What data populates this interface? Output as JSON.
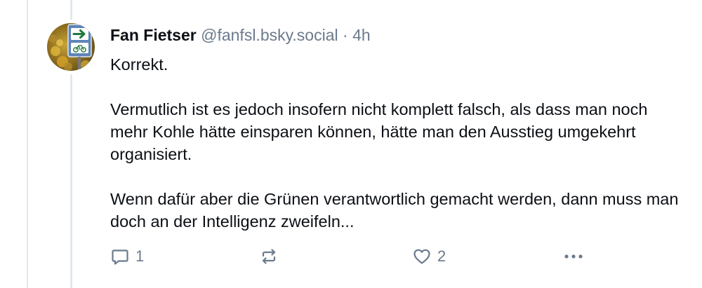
{
  "post": {
    "author_name": "Fan Fietser",
    "handle": "@fanfsl.bsky.social",
    "separator": " · ",
    "time": "4h",
    "paragraphs": [
      "Korrekt.",
      "Vermutlich ist es jedoch insofern nicht komplett falsch, als dass man noch mehr Kohle hätte einsparen können, hätte man den Ausstieg umgekehrt organisiert.",
      "Wenn dafür aber die Grünen verantwortlich gemacht werden, dann muss man doch an der Intelligenz zweifeln..."
    ]
  },
  "actions": {
    "reply_count": "1",
    "like_count": "2"
  },
  "icons": {
    "reply": "reply-bubble-icon",
    "repost": "repost-arrows-icon",
    "like": "heart-icon",
    "more": "more-dots-icon"
  },
  "colors": {
    "text": "#0b0f14",
    "muted": "#6b7a8c",
    "thread_line": "#e3e8ee"
  }
}
